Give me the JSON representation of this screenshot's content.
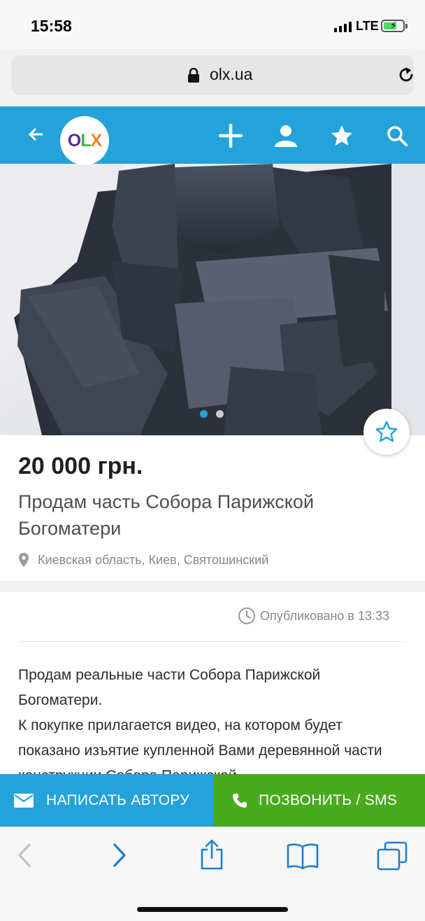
{
  "status_bar": {
    "time": "15:58",
    "network": "LTE",
    "battery_level": 0.6
  },
  "browser": {
    "url": "olx.ua"
  },
  "header": {
    "logo": "OLX",
    "icons": [
      "back-arrow-icon",
      "olx-logo",
      "plus-icon",
      "user-icon",
      "star-icon",
      "search-icon"
    ]
  },
  "gallery": {
    "total_images": 2,
    "active_index": 0
  },
  "listing": {
    "price": "20 000 грн.",
    "title": "Продам часть Собора Парижской Богоматери",
    "location": "Киевская область, Киев, Святошинский",
    "published": "Опубликовано в 13:33",
    "description": "Продам реальные части Собора Парижской Богоматери.\nК покупке прилагается видео, на котором будет показано изъятие купленной Вами деревянной части конструкции Собора Парижской"
  },
  "actions": {
    "write_label": "НАПИСАТЬ АВТОРУ",
    "call_label": "ПОЗВОНИТЬ / SMS"
  },
  "colors": {
    "brand": "#23a3d9",
    "call": "#4aaa1f"
  }
}
